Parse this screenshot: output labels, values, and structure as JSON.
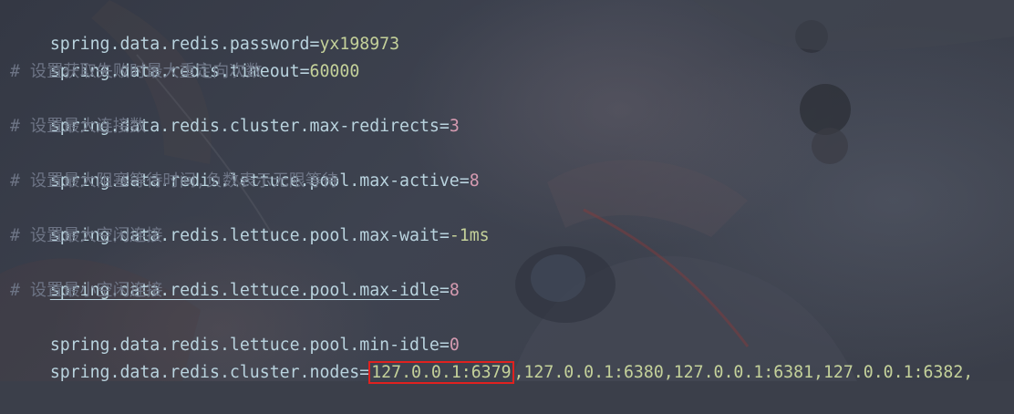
{
  "editor": {
    "lines": [
      {
        "type": "property",
        "key": "spring.data.redis.password",
        "value": "yx198973",
        "value_kind": "string"
      },
      {
        "type": "property",
        "key": "spring.data.redis.timeout",
        "value": "60000",
        "value_kind": "string"
      },
      {
        "type": "comment",
        "text": "# 设置获取失败时最大重定向次数"
      },
      {
        "type": "property",
        "key": "spring.data.redis.cluster.max-redirects",
        "value": "3",
        "value_kind": "number"
      },
      {
        "type": "comment",
        "text": "# 设置最大连接数"
      },
      {
        "type": "property",
        "key": "spring.data.redis.lettuce.pool.max-active",
        "value": "8",
        "value_kind": "number"
      },
      {
        "type": "comment",
        "text": "# 设置最大阻塞等待时间,负数表示无限等待"
      },
      {
        "type": "property",
        "key": "spring.data.redis.lettuce.pool.max-wait",
        "value": "-1ms",
        "value_kind": "string"
      },
      {
        "type": "comment",
        "text": "# 设置最大空闲连接"
      },
      {
        "type": "property",
        "key": "spring.data.redis.lettuce.pool.max-idle",
        "value": "8",
        "value_kind": "number"
      },
      {
        "type": "comment",
        "text": "# 设置最小空闲连接"
      },
      {
        "type": "property",
        "key": "spring.data.redis.lettuce.pool.min-idle",
        "value": "0",
        "value_kind": "number"
      },
      {
        "type": "property",
        "key": "spring.data.redis.cluster.nodes",
        "value_highlighted": "127.0.0.1:6379",
        "value_rest": ",127.0.0.1:6380,127.0.0.1:6381,127.0.0.1:6382,",
        "value_kind": "string"
      }
    ],
    "equals": "=",
    "colors": {
      "key": "#b9d3de",
      "string_value": "#c4d19a",
      "number_value": "#d49ab0",
      "comment": "#6d7485",
      "highlight_box": "#e0211f",
      "background": "#3b3f4a"
    }
  }
}
